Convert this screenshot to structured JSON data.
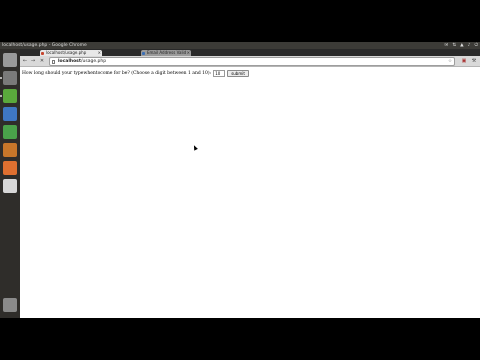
{
  "os": {
    "window_title": "localhost/usage.php - Google Chrome",
    "tray": [
      "✉",
      "⇅",
      "▲",
      "♪",
      "⏻"
    ]
  },
  "launcher": [
    {
      "name": "dash-home-icon",
      "color": "#9a9a9a",
      "active": false
    },
    {
      "name": "files-icon",
      "color": "#7a7a7a",
      "active": true
    },
    {
      "name": "chrome-icon",
      "color": "#5aa83c",
      "active": true
    },
    {
      "name": "writer-icon",
      "color": "#3f77c2",
      "active": false
    },
    {
      "name": "calc-icon",
      "color": "#4aa24a",
      "active": false
    },
    {
      "name": "impress-icon",
      "color": "#c8772a",
      "active": false
    },
    {
      "name": "software-center-icon",
      "color": "#e07030",
      "active": false
    },
    {
      "name": "settings-icon",
      "color": "#d8d8d8",
      "active": false
    },
    {
      "name": "trash-icon",
      "color": "#8a8a8a",
      "active": false
    }
  ],
  "tabs": [
    {
      "label": "localhost/usage.php",
      "close": "×",
      "favicon_color": "#c7452e"
    },
    {
      "label": "Email Address Valid",
      "close": "×",
      "favicon_color": "#3b6fb6"
    }
  ],
  "toolbar": {
    "back": "←",
    "forward": "→",
    "reload": "✕",
    "url_host": "localhost",
    "url_path": "/usage.php",
    "star": "☆",
    "ext_icon": "▣",
    "wrench": "⚒"
  },
  "page": {
    "question": "How long should your typewhentocome for be? (Choose a digit between 1 and 10):",
    "input_value": "10",
    "submit_label": "submit"
  }
}
